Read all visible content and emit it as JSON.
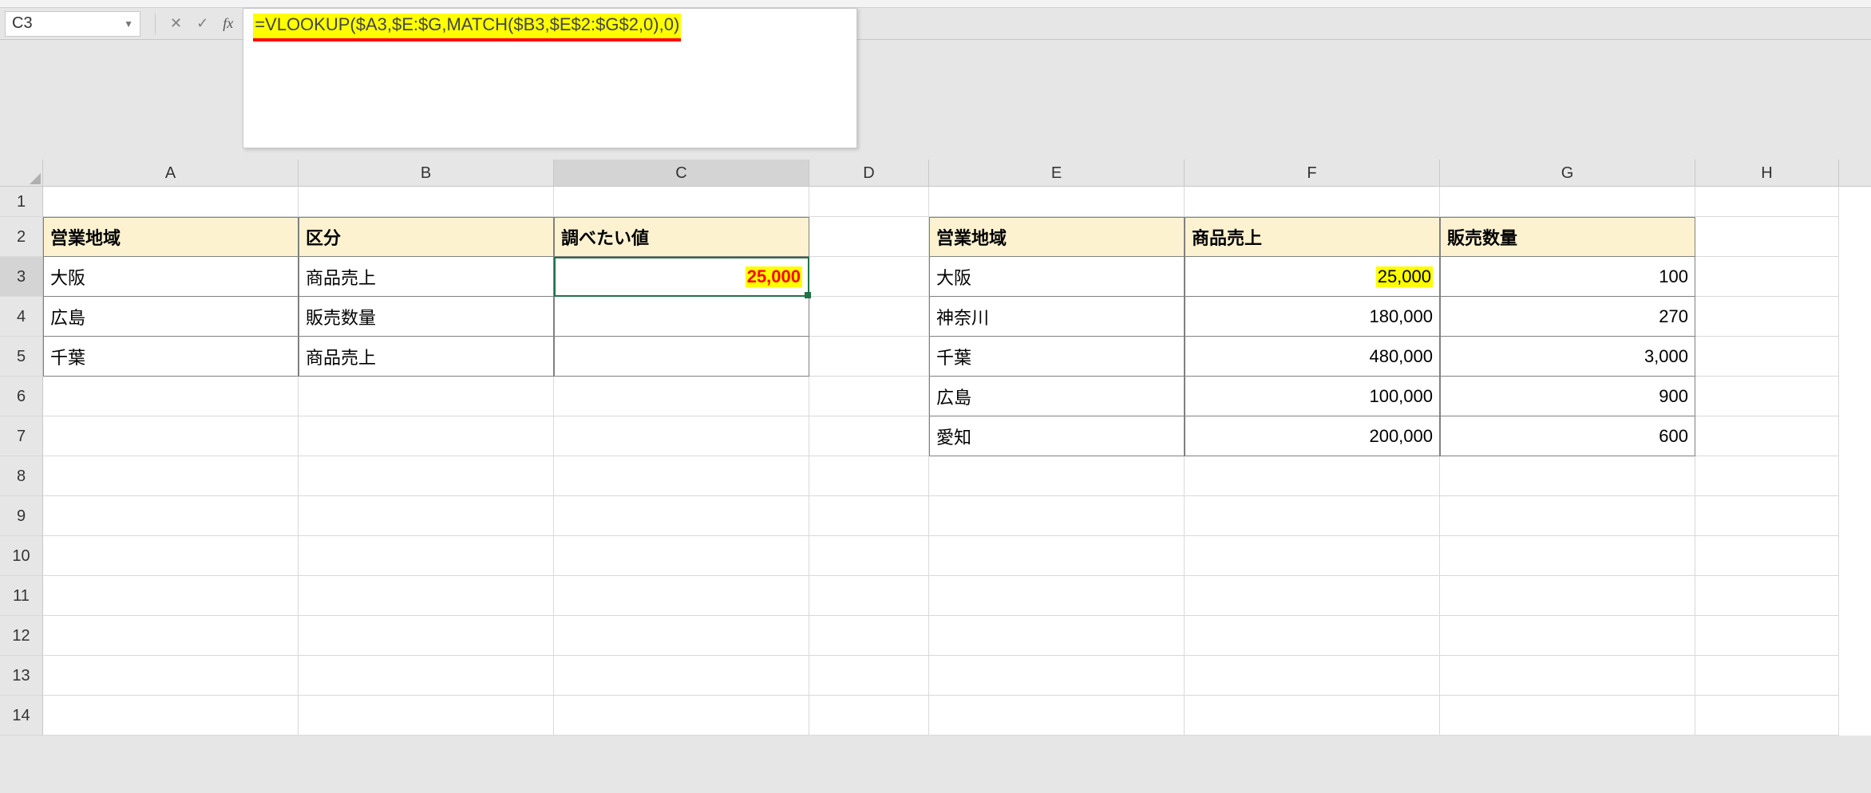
{
  "name_box": "C3",
  "formula": "=VLOOKUP($A3,$E:$G,MATCH($B3,$E$2:$G$2,0),0)",
  "columns": [
    "A",
    "B",
    "C",
    "D",
    "E",
    "F",
    "G",
    "H"
  ],
  "row_labels": [
    "1",
    "2",
    "3",
    "4",
    "5",
    "6",
    "7",
    "8",
    "9",
    "10",
    "11",
    "12",
    "13",
    "14"
  ],
  "left_table": {
    "headers": {
      "A": "営業地域",
      "B": "区分",
      "C": "調べたい値"
    },
    "rows": [
      {
        "A": "大阪",
        "B": "商品売上",
        "C": "25,000"
      },
      {
        "A": "広島",
        "B": "販売数量",
        "C": ""
      },
      {
        "A": "千葉",
        "B": "商品売上",
        "C": ""
      }
    ]
  },
  "right_table": {
    "headers": {
      "E": "営業地域",
      "F": "商品売上",
      "G": "販売数量"
    },
    "rows": [
      {
        "E": "大阪",
        "F": "25,000",
        "G": "100"
      },
      {
        "E": "神奈川",
        "F": "180,000",
        "G": "270"
      },
      {
        "E": "千葉",
        "F": "480,000",
        "G": "3,000"
      },
      {
        "E": "広島",
        "F": "100,000",
        "G": "900"
      },
      {
        "E": "愛知",
        "F": "200,000",
        "G": "600"
      }
    ]
  },
  "chart_data": {
    "type": "table",
    "title": "",
    "lookup_table": {
      "columns": [
        "営業地域",
        "商品売上",
        "販売数量"
      ],
      "rows": [
        [
          "大阪",
          25000,
          100
        ],
        [
          "神奈川",
          180000,
          270
        ],
        [
          "千葉",
          480000,
          3000
        ],
        [
          "広島",
          100000,
          900
        ],
        [
          "愛知",
          200000,
          600
        ]
      ]
    },
    "query_table": {
      "columns": [
        "営業地域",
        "区分",
        "調べたい値"
      ],
      "rows": [
        [
          "大阪",
          "商品売上",
          25000
        ],
        [
          "広島",
          "販売数量",
          null
        ],
        [
          "千葉",
          "商品売上",
          null
        ]
      ]
    }
  }
}
